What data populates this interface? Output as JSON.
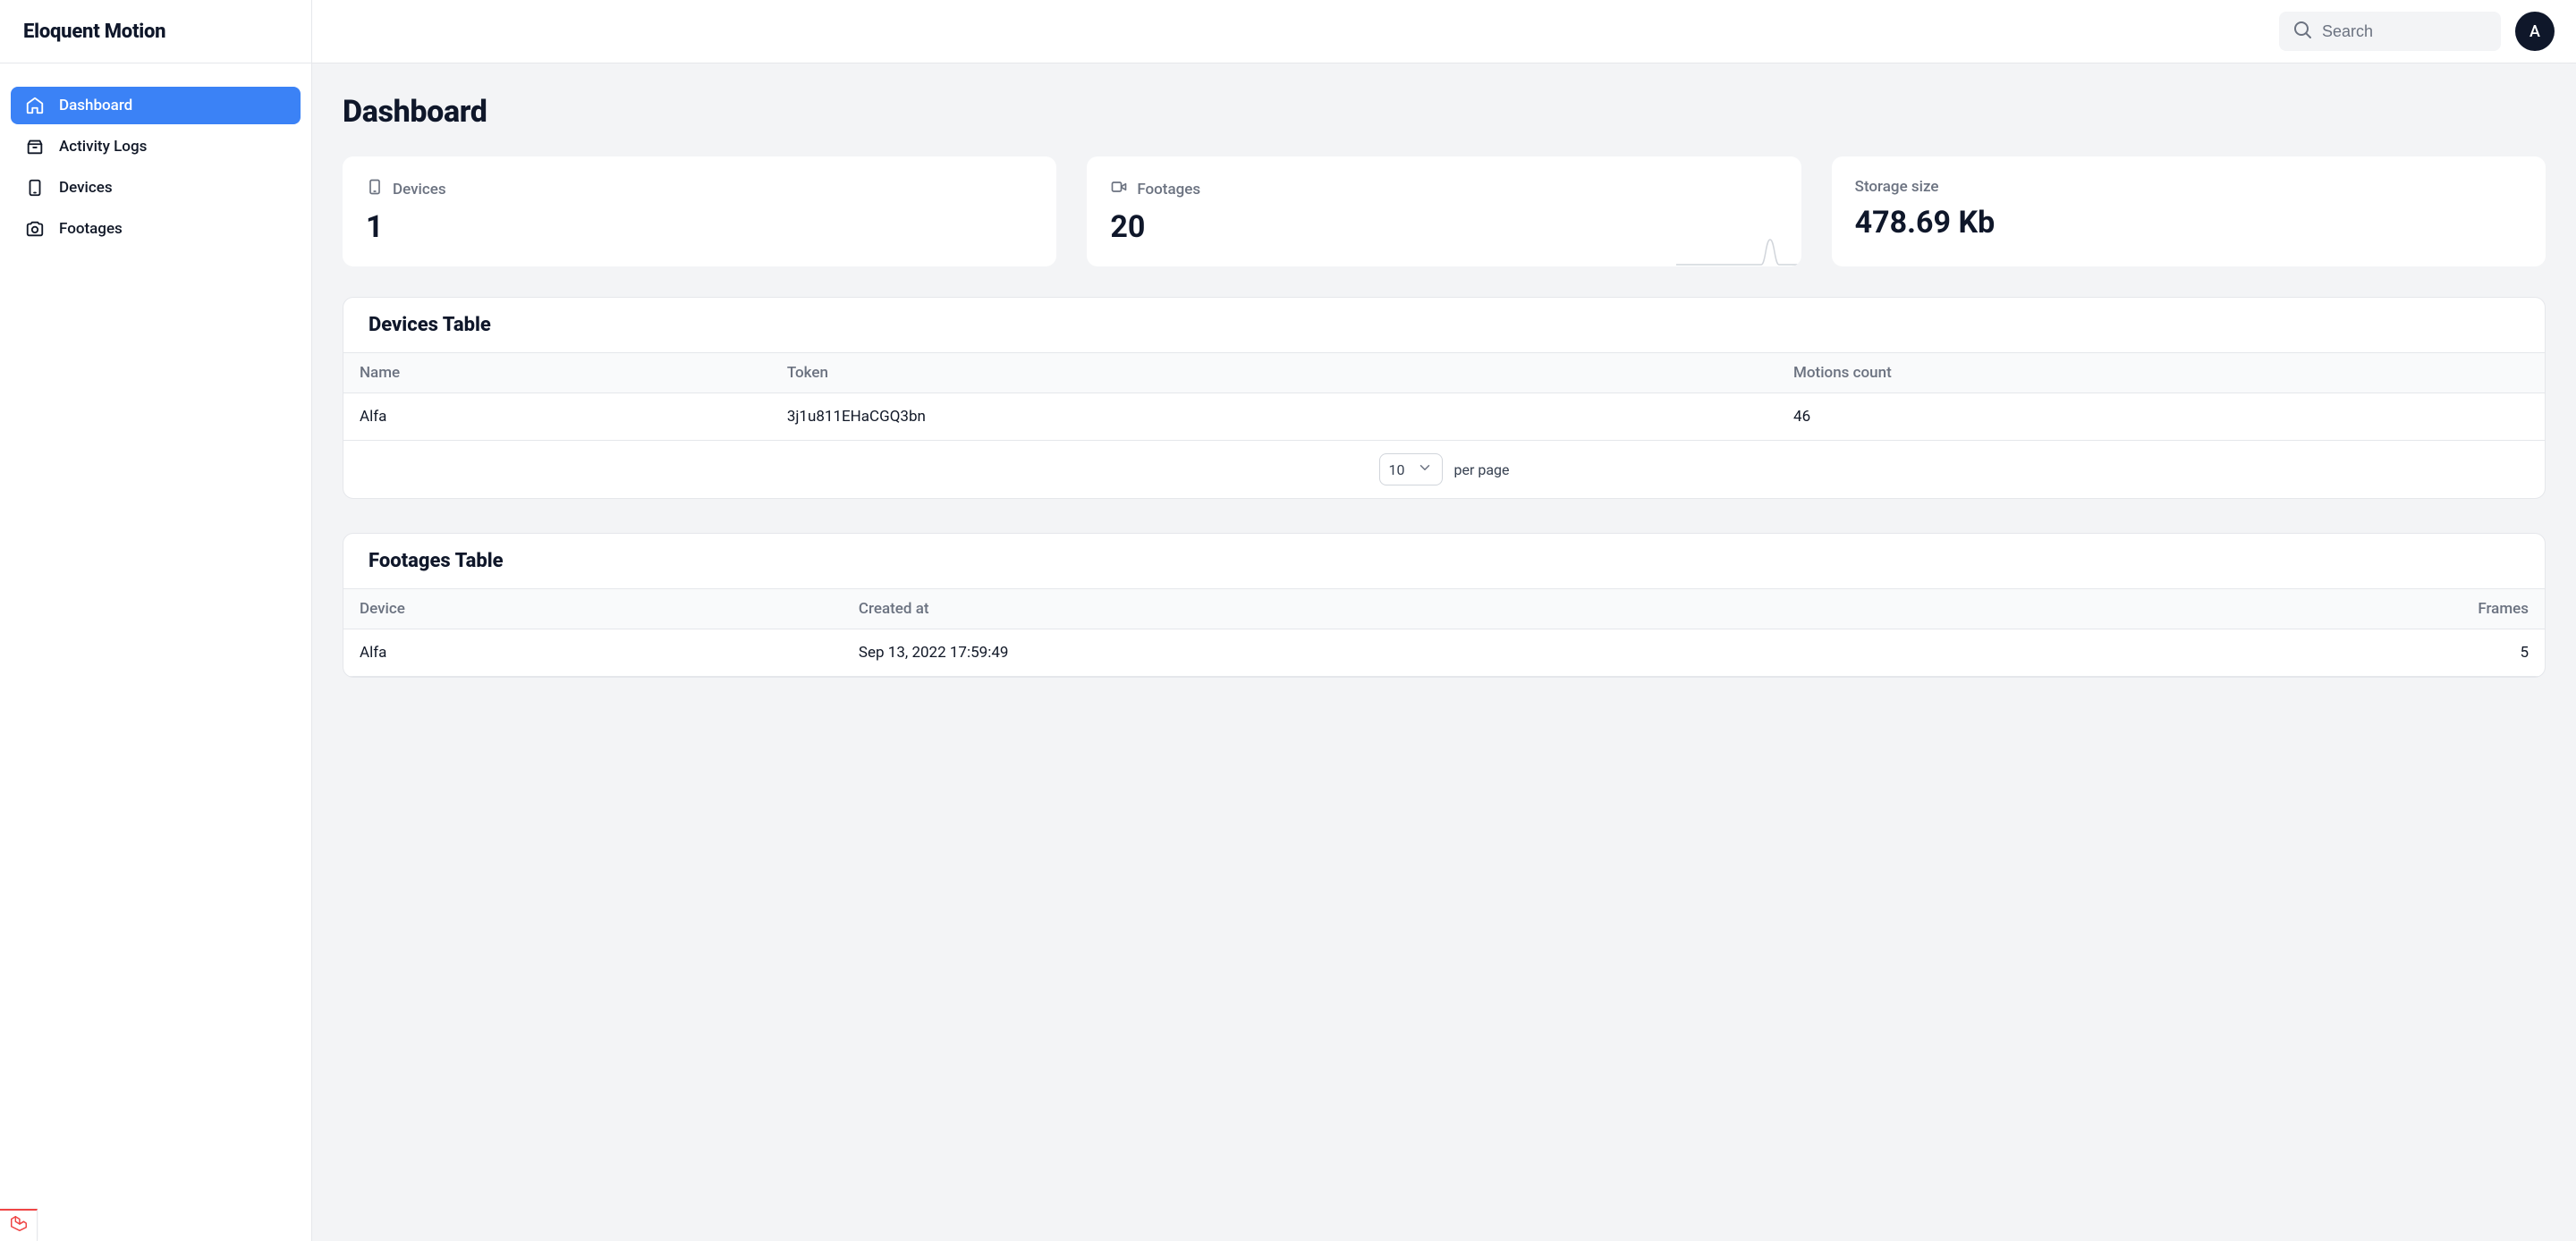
{
  "brand": "Eloquent Motion",
  "search": {
    "placeholder": "Search"
  },
  "avatar": {
    "initial": "A"
  },
  "sidebar": {
    "items": [
      {
        "label": "Dashboard"
      },
      {
        "label": "Activity Logs"
      },
      {
        "label": "Devices"
      },
      {
        "label": "Footages"
      }
    ]
  },
  "page": {
    "title": "Dashboard"
  },
  "stats": {
    "devices": {
      "label": "Devices",
      "value": "1"
    },
    "footages": {
      "label": "Footages",
      "value": "20"
    },
    "storage": {
      "label": "Storage size",
      "value": "478.69 Kb"
    }
  },
  "devices_table": {
    "title": "Devices Table",
    "columns": [
      "Name",
      "Token",
      "Motions count"
    ],
    "rows": [
      {
        "name": "Alfa",
        "token": "3j1u811EHaCGQ3bn",
        "motions": "46"
      }
    ],
    "pagination": {
      "per_page_value": "10",
      "per_page_label": "per page"
    }
  },
  "footages_table": {
    "title": "Footages Table",
    "columns": [
      "Device",
      "Created at",
      "Frames"
    ],
    "rows": [
      {
        "device": "Alfa",
        "created_at": "Sep 13, 2022 17:59:49",
        "frames": "5"
      }
    ]
  }
}
